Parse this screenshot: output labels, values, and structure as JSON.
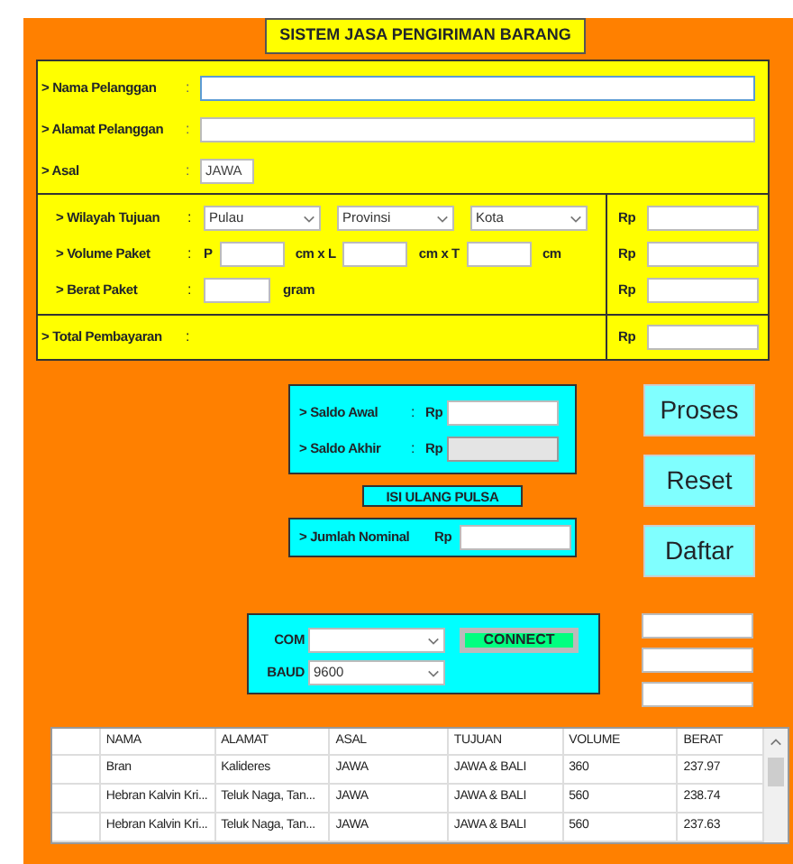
{
  "title": "SISTEM JASA PENGIRIMAN BARANG",
  "customer": [
    {
      "label": "> Nama Pelanggan",
      "colon": ":",
      "kind": "wide",
      "focused": true
    },
    {
      "label": "> Alamat Pelanggan",
      "colon": ":",
      "kind": "wide",
      "focused": false
    },
    {
      "label": "> Asal",
      "colon": ":",
      "kind": "short",
      "value": "JAWA",
      "focused": false
    }
  ],
  "shipment": [
    {
      "kind": "destination",
      "label": "> Wilayah Tujuan",
      "colon": ":",
      "selects": [
        "Pulau",
        "Provinsi",
        "Kota"
      ],
      "currency": "Rp"
    },
    {
      "kind": "volume",
      "label": "> Volume Paket",
      "colon": ":",
      "parts": [
        "P",
        "cm x L",
        "cm x T",
        "cm"
      ],
      "currency": "Rp"
    },
    {
      "kind": "weight",
      "label": "> Berat Paket",
      "colon": ":",
      "unit": "gram",
      "currency": "Rp"
    }
  ],
  "total": {
    "label": "> Total Pembayaran",
    "colon": ":",
    "currency": "Rp"
  },
  "balance": [
    {
      "label": "> Saldo Awal",
      "colon": ":",
      "currency": "Rp",
      "disabled": false
    },
    {
      "label": "> Saldo Akhir",
      "colon": ":",
      "currency": "Rp",
      "disabled": true
    }
  ],
  "topup": {
    "title": "ISI ULANG PULSA",
    "label": "> Jumlah Nominal",
    "currency": "Rp"
  },
  "buttons": [
    "Proses",
    "Reset",
    "Daftar"
  ],
  "serial": {
    "fields": [
      {
        "label": "COM"
      },
      {
        "label": "BAUD",
        "value": "9600"
      }
    ],
    "connect": "CONNECT"
  },
  "table": {
    "columns": [
      "NAMA",
      "ALAMAT",
      "ASAL",
      "TUJUAN",
      "VOLUME",
      "BERAT"
    ],
    "rows": [
      [
        "Bran",
        "Kalideres",
        "JAWA",
        "JAWA & BALI",
        "360",
        "237.97"
      ],
      [
        "Hebran Kalvin Kri...",
        "Teluk Naga, Tan...",
        "JAWA",
        "JAWA & BALI",
        "560",
        "238.74"
      ],
      [
        "Hebran Kalvin Kri...",
        "Teluk Naga, Tan...",
        "JAWA",
        "JAWA & BALI",
        "560",
        "237.63"
      ]
    ]
  }
}
